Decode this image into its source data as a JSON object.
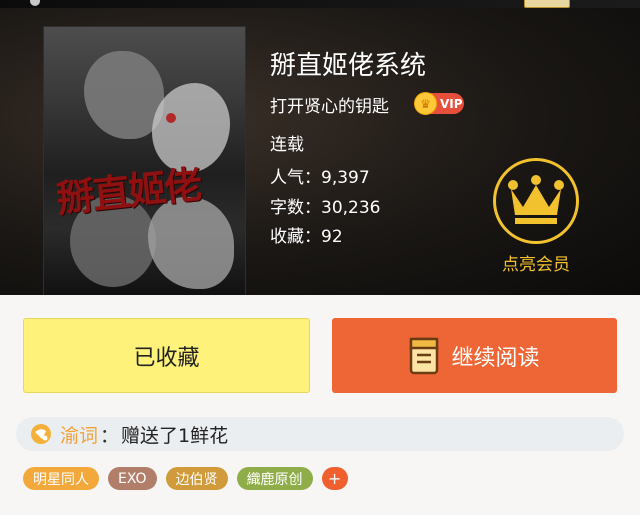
{
  "book": {
    "title": "掰直姬佬系统",
    "author": "打开贤心的钥匙",
    "vip_label": "VIP",
    "cover_text": "掰直姬佬",
    "status": "连载",
    "popularity": "人气：9,397",
    "word_count": "字数：30,236",
    "favorites": "收藏：92"
  },
  "member": {
    "label": "点亮会员",
    "icon": "crown-icon"
  },
  "actions": {
    "favorite_label": "已收藏",
    "read_label": "继续阅读",
    "read_icon": "book-icon"
  },
  "gift": {
    "icon": "flower-icon",
    "user": "渝词",
    "separator": "：",
    "message": "赠送了1鲜花"
  },
  "tags": [
    "明星同人",
    "EXO",
    "边伯贤",
    "織鹿原创"
  ],
  "tag_add": "+",
  "colors": {
    "accent_orange": "#ee6635",
    "favorite_yellow": "#fef27a",
    "crown_gold": "#f2c12e",
    "vip_red": "#e84e3c"
  }
}
